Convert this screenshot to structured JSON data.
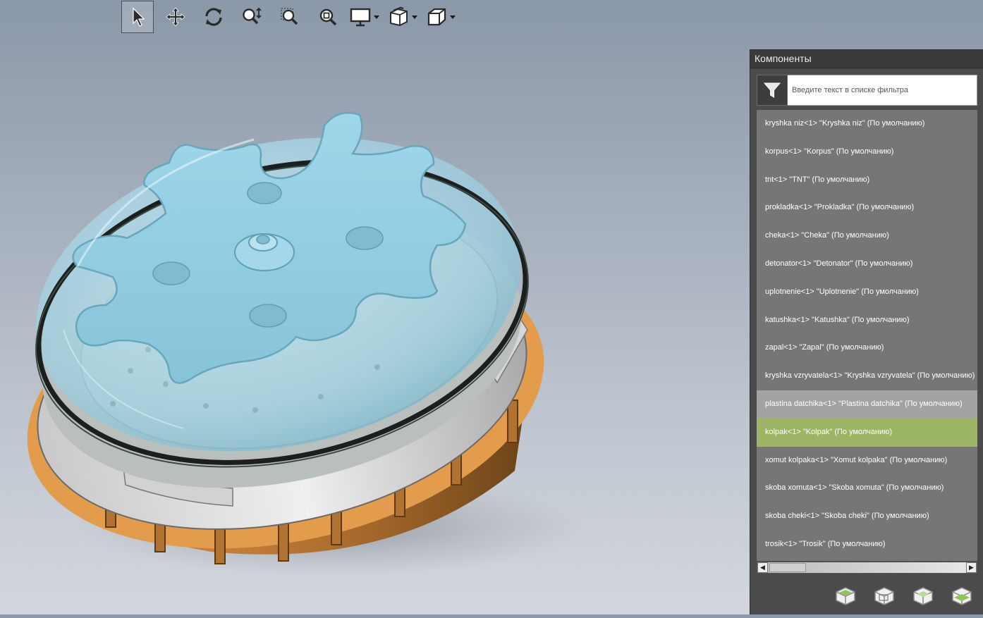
{
  "toolbar": {
    "buttons": [
      {
        "icon": "select-arrow-icon",
        "active": true
      },
      {
        "icon": "pan-move-icon"
      },
      {
        "icon": "rotate-icon"
      },
      {
        "icon": "zoom-icon"
      },
      {
        "icon": "zoom-area-icon"
      },
      {
        "icon": "zoom-fit-icon"
      },
      {
        "icon": "display-mode-icon",
        "dropdown": true
      },
      {
        "icon": "section-view-icon",
        "dropdown": true
      },
      {
        "icon": "view-cube-icon",
        "dropdown": true
      }
    ]
  },
  "panel": {
    "title": "Компоненты",
    "filter": {
      "placeholder": "Введите текст в списке фильтра",
      "value": ""
    },
    "components": [
      "kryshka niz<1> \"Kryshka niz\" (По умолчанию)",
      "korpus<1> \"Korpus\" (По умолчанию)",
      "tnt<1> \"TNT\" (По умолчанию)",
      "prokladka<1> \"Prokladka\" (По умолчанию)",
      "cheka<1> \"Cheka\" (По умолчанию)",
      "detonator<1> \"Detonator\" (По умолчанию)",
      "uplotnenie<1> \"Uplotnenie\" (По умолчанию)",
      "katushka<1> \"Katushka\" (По умолчанию)",
      "zapal<1> \"Zapal\" (По умолчанию)",
      "kryshka vzryvatela<1> \"Kryshka vzryvatela\" (По умолчанию)",
      "plastina datchika<1> \"Plastina datchika\" (По умолчанию)",
      "kolpak<1> \"Kolpak\" (По умолчанию)",
      "xomut kolpaka<1> \"Xomut kolpaka\" (По умолчанию)",
      "skoba xomuta<1> \"Skoba xomuta\" (По умолчанию)",
      "skoba cheki<1> \"Skoba cheki\" (По умолчанию)",
      "trosik<1> \"Trosik\" (По умолчанию)"
    ],
    "hover_index": 10,
    "selected_index": 11,
    "bottom_icons": [
      "show-component-icon",
      "hide-component-icon",
      "transparent-component-icon",
      "isolate-component-icon"
    ]
  },
  "colors": {
    "selected_row": "#9bb564",
    "hover_row": "#a3a3a3",
    "list_bg": "#767676",
    "panel_bg": "#4b4b4b",
    "body_orange": "#e09a4a",
    "dome_glass": "#9fd3e6"
  }
}
